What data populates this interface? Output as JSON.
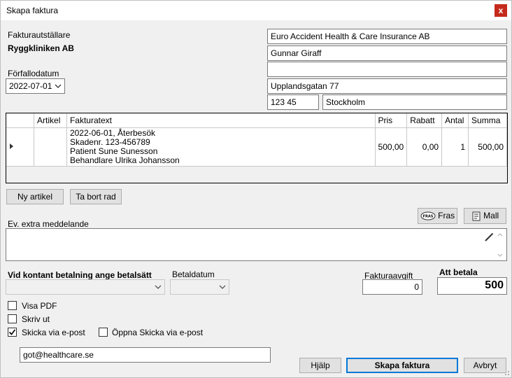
{
  "window": {
    "title": "Skapa faktura",
    "close_label": "x"
  },
  "issuer": {
    "label": "Fakturautställare",
    "name": "Ryggkliniken AB"
  },
  "due_date": {
    "label": "Förfallodatum",
    "value": "2022-07-01"
  },
  "recipient": {
    "company": "Euro Accident Health & Care Insurance AB",
    "contact": "Gunnar Giraff",
    "address_line2": "",
    "street": "Upplandsgatan 77",
    "zip": "123 45",
    "city": "Stockholm"
  },
  "grid": {
    "columns": [
      "Artikel",
      "Fakturatext",
      "Pris",
      "Rabatt",
      "Antal",
      "Summa"
    ],
    "rows": [
      {
        "article": "",
        "text_lines": [
          "2022-06-01, Återbesök",
          "Skadenr. 123-456789",
          "Patient Sune Sunesson",
          "Behandlare Ulrika Johansson"
        ],
        "price": "500,00",
        "discount": "0,00",
        "quantity": "1",
        "sum": "500,00"
      }
    ]
  },
  "buttons": {
    "new_article": "Ny artikel",
    "delete_row": "Ta bort rad",
    "fras": "Fras",
    "mall": "Mall",
    "help": "Hjälp",
    "create_invoice": "Skapa faktura",
    "cancel": "Avbryt"
  },
  "icons": {
    "fras": "speech-bubble-icon",
    "mall": "template-icon",
    "edit": "pencil-icon"
  },
  "extra_message": {
    "label": "Ev. extra meddelande",
    "value": ""
  },
  "payment": {
    "method_label": "Vid kontant betalning ange betalsätt",
    "method_value": "",
    "date_label": "Betaldatum",
    "date_value": ""
  },
  "fee": {
    "label": "Fakturaavgift",
    "value": "0"
  },
  "total": {
    "label": "Att betala",
    "value": "500"
  },
  "options": {
    "show_pdf": {
      "label": "Visa PDF",
      "checked": false
    },
    "print": {
      "label": "Skriv ut",
      "checked": false
    },
    "send_email": {
      "label": "Skicka via e-post",
      "checked": true
    },
    "open_send_email": {
      "label": "Öppna Skicka via e-post",
      "checked": false
    }
  },
  "email": {
    "value": "got@healthcare.se"
  }
}
